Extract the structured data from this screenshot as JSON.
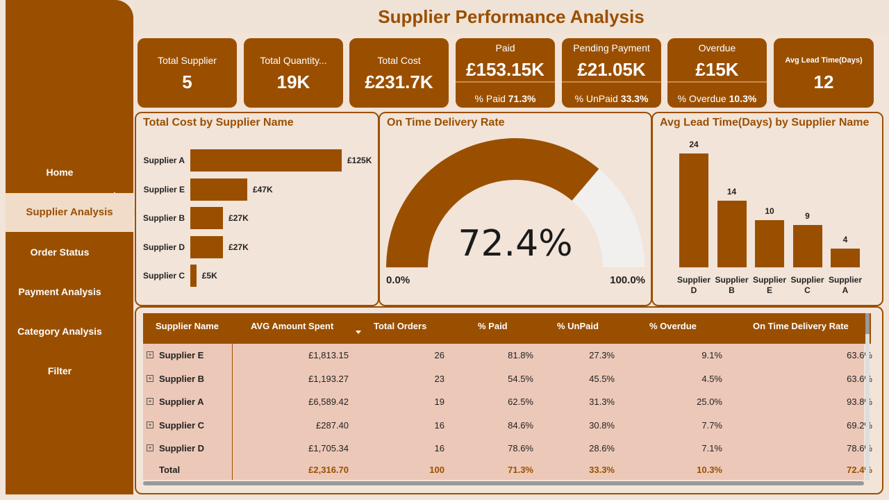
{
  "title": "Supplier Performance Analysis",
  "nav": {
    "items": [
      {
        "label": "Home"
      },
      {
        "label": "Supplier Analysis"
      },
      {
        "label": "Order Status"
      },
      {
        "label": "Payment Analysis"
      },
      {
        "label": "Category Analysis"
      },
      {
        "label": "Filter"
      }
    ],
    "active": "Supplier Analysis"
  },
  "kpis": {
    "total_supplier": {
      "label": "Total Supplier",
      "value": "5"
    },
    "total_quantity": {
      "label": "Total Quantity...",
      "value": "19K"
    },
    "total_cost": {
      "label": "Total Cost",
      "value": "£231.7K"
    },
    "paid": {
      "label": "Paid",
      "value": "£153.15K",
      "sub_label": "% Paid",
      "sub_value": "71.3%"
    },
    "pending": {
      "label": "Pending Payment",
      "value": "£21.05K",
      "sub_label": "% UnPaid",
      "sub_value": "33.3%"
    },
    "overdue": {
      "label": "Overdue",
      "value": "£15K",
      "sub_label": "% Overdue",
      "sub_value": "10.3%"
    },
    "avg_lead": {
      "label": "Avg Lead Time(Days)",
      "value": "12"
    }
  },
  "colors": {
    "accent": "#9a4f00",
    "background": "#f2e4d8",
    "row_bg": "#ecc8b8",
    "gauge_track": "#f2f0ef"
  },
  "chart_data": [
    {
      "type": "bar",
      "orientation": "horizontal",
      "title": "Total Cost by Supplier Name",
      "categories": [
        "Supplier A",
        "Supplier E",
        "Supplier B",
        "Supplier D",
        "Supplier C"
      ],
      "values": [
        125,
        47,
        27,
        27,
        5
      ],
      "value_labels": [
        "£125K",
        "£47K",
        "£27K",
        "£27K",
        "£5K"
      ],
      "unit": "£K"
    },
    {
      "type": "gauge",
      "title": "On Time Delivery Rate",
      "value": 72.4,
      "value_label": "72.4%",
      "min_label": "0.0%",
      "max_label": "100.0%",
      "min": 0,
      "max": 100
    },
    {
      "type": "bar",
      "orientation": "vertical",
      "title": "Avg Lead Time(Days) by Supplier Name",
      "categories": [
        "Supplier D",
        "Supplier B",
        "Supplier E",
        "Supplier C",
        "Supplier A"
      ],
      "values": [
        24,
        14,
        10,
        9,
        4
      ],
      "ylim": [
        0,
        24
      ]
    }
  ],
  "table": {
    "sort_icon": "sort-descending-icon",
    "columns": [
      "Supplier Name",
      "AVG Amount Spent",
      "Total Orders",
      "% Paid",
      "% UnPaid",
      "% Overdue",
      "On Time Delivery Rate"
    ],
    "rows": [
      {
        "name": "Supplier E",
        "avg": "£1,813.15",
        "orders": "26",
        "paid": "81.8%",
        "unpaid": "27.3%",
        "overdue": "9.1%",
        "ontime": "63.6%"
      },
      {
        "name": "Supplier B",
        "avg": "£1,193.27",
        "orders": "23",
        "paid": "54.5%",
        "unpaid": "45.5%",
        "overdue": "4.5%",
        "ontime": "63.6%"
      },
      {
        "name": "Supplier A",
        "avg": "£6,589.42",
        "orders": "19",
        "paid": "62.5%",
        "unpaid": "31.3%",
        "overdue": "25.0%",
        "ontime": "93.8%"
      },
      {
        "name": "Supplier C",
        "avg": "£287.40",
        "orders": "16",
        "paid": "84.6%",
        "unpaid": "30.8%",
        "overdue": "7.7%",
        "ontime": "69.2%"
      },
      {
        "name": "Supplier D",
        "avg": "£1,705.34",
        "orders": "16",
        "paid": "78.6%",
        "unpaid": "28.6%",
        "overdue": "7.1%",
        "ontime": "78.6%"
      }
    ],
    "total": {
      "name": "Total",
      "avg": "£2,316.70",
      "orders": "100",
      "paid": "71.3%",
      "unpaid": "33.3%",
      "overdue": "10.3%",
      "ontime": "72.4%"
    }
  }
}
